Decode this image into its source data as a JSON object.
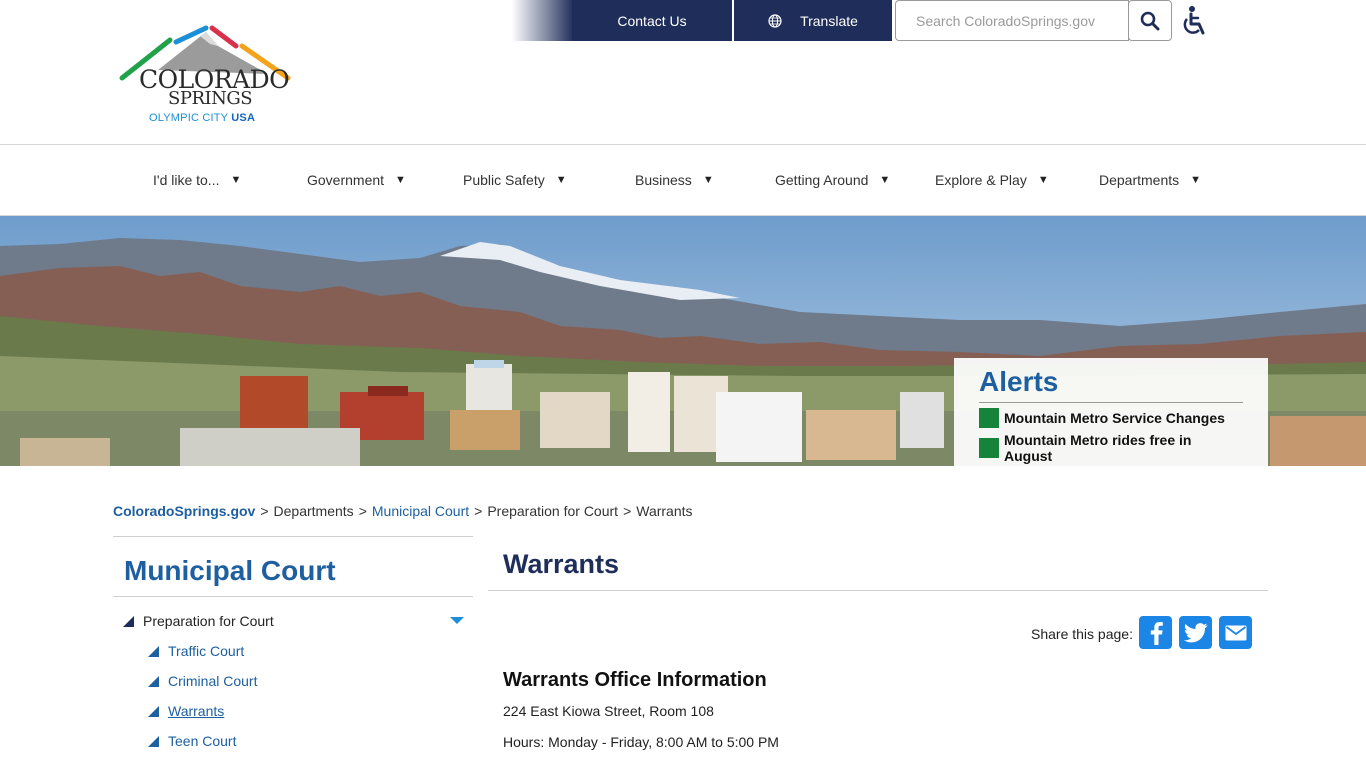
{
  "header": {
    "logo": {
      "line1": "COLORADO",
      "line2": "SPRINGS",
      "tagline_a": "OLYMPIC CITY",
      "tagline_b": "USA"
    },
    "contact_label": "Contact Us",
    "translate_label": "Translate",
    "search_placeholder": "Search ColoradoSprings.gov",
    "icons": {
      "translate": "globe-icon",
      "search": "search-icon",
      "accessibility": "wheelchair-icon"
    }
  },
  "nav": {
    "items": [
      {
        "label": "I'd like to..."
      },
      {
        "label": "Government"
      },
      {
        "label": "Public Safety"
      },
      {
        "label": "Business"
      },
      {
        "label": "Getting Around"
      },
      {
        "label": "Explore & Play"
      },
      {
        "label": "Departments"
      }
    ],
    "caret": "▼"
  },
  "alerts": {
    "title": "Alerts",
    "items": [
      {
        "label": "Mountain Metro Service Changes"
      },
      {
        "label": "Mountain Metro rides free in August"
      }
    ]
  },
  "breadcrumb": {
    "separator": ">",
    "items": [
      {
        "label": "ColoradoSprings.gov"
      },
      {
        "label": "Departments"
      },
      {
        "label": "Municipal Court"
      },
      {
        "label": "Preparation for Court"
      },
      {
        "label": "Warrants"
      }
    ]
  },
  "sidebar": {
    "title": "Municipal Court",
    "parent": {
      "label": "Preparation for Court"
    },
    "children": [
      {
        "label": "Traffic Court"
      },
      {
        "label": "Criminal Court"
      },
      {
        "label": "Warrants"
      },
      {
        "label": "Teen Court"
      }
    ]
  },
  "main": {
    "title": "Warrants",
    "share_label": "Share this page:",
    "share_icons": [
      "facebook-icon",
      "twitter-icon",
      "email-icon"
    ],
    "section_title": "Warrants Office Information",
    "address": "224 East Kiowa Street, Room 108",
    "hours": "Hours: Monday - Friday, 8:00 AM to 5:00 PM"
  },
  "colors": {
    "navy": "#1f2d5a",
    "link_blue": "#1e5fa0",
    "share_blue": "#1c86e6",
    "alert_green": "#17833a"
  }
}
